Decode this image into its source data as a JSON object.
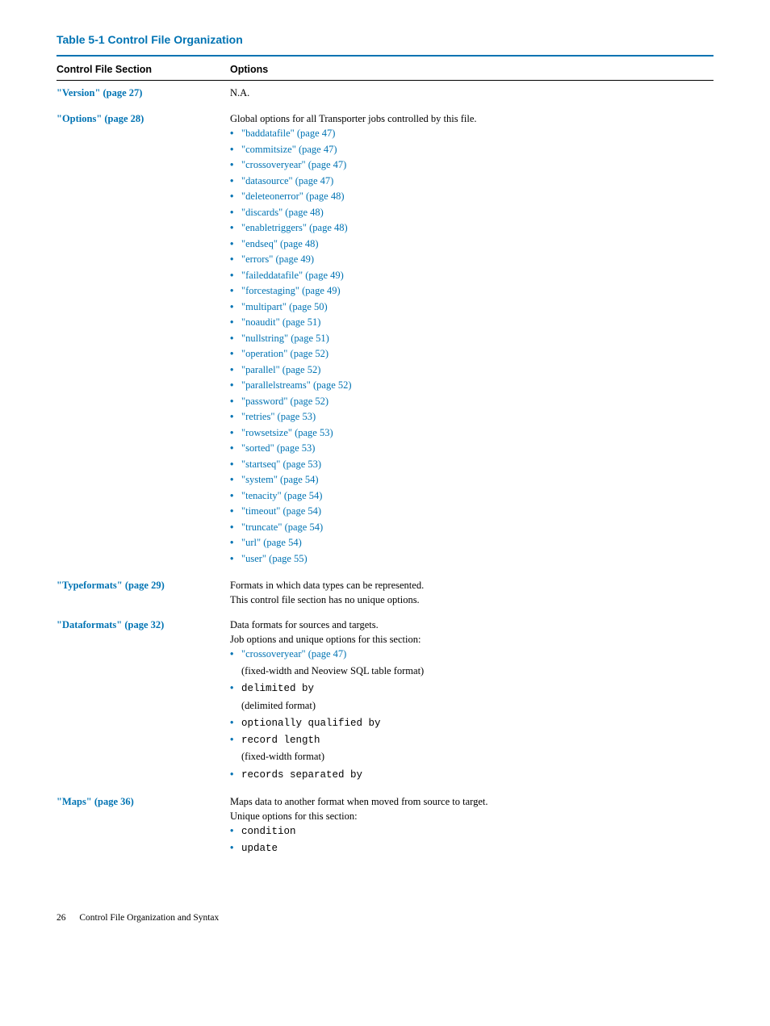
{
  "caption": "Table  5-1  Control File Organization",
  "headers": {
    "col1": "Control File Section",
    "col2": "Options"
  },
  "rows": {
    "version": {
      "section": "\"Version\" (page 27)",
      "options": "N.A."
    },
    "options": {
      "section": "\"Options\" (page 28)",
      "intro": "Global options for all Transporter jobs controlled by this file.",
      "items": [
        "\"baddatafile\" (page 47)",
        "\"commitsize\" (page 47)",
        "\"crossoveryear\" (page 47)",
        "\"datasource\" (page 47)",
        "\"deleteonerror\" (page 48)",
        "\"discards\" (page 48)",
        "\"enabletriggers\" (page 48)",
        "\"endseq\" (page 48)",
        "\"errors\" (page 49)",
        "\"faileddatafile\" (page 49)",
        "\"forcestaging\" (page 49)",
        "\"multipart\" (page 50)",
        "\"noaudit\" (page 51)",
        "\"nullstring\" (page 51)",
        "\"operation\" (page 52)",
        "\"parallel\" (page 52)",
        "\"parallelstreams\" (page 52)",
        "\"password\" (page 52)",
        "\"retries\" (page 53)",
        "\"rowsetsize\" (page 53)",
        "\"sorted\" (page 53)",
        "\"startseq\" (page 53)",
        "\"system\" (page 54)",
        "\"tenacity\" (page 54)",
        "\"timeout\" (page 54)",
        "\"truncate\" (page 54)",
        "\"url\" (page 54)",
        "\"user\" (page 55)"
      ]
    },
    "typeformats": {
      "section": "\"Typeformats\" (page 29)",
      "line1": "Formats in which data types can be represented.",
      "line2": "This control file section has no unique options."
    },
    "dataformats": {
      "section": "\"Dataformats\" (page 32)",
      "line1": "Data formats for sources and targets.",
      "line2": "Job options and unique options for this section:",
      "b1_main": "\"crossoveryear\" (page 47)",
      "b1_sub": "(fixed-width and Neoview SQL table format)",
      "b2_main": "delimited by",
      "b2_sub": "(delimited format)",
      "b3_main": "optionally qualified by",
      "b4_main": "record length",
      "b4_sub": "(fixed-width format)",
      "b5_main": "records separated by"
    },
    "maps": {
      "section": "\"Maps\" (page 36)",
      "line1": "Maps data to another format when moved from source to target.",
      "line2": "Unique options for this section:",
      "items": [
        "condition",
        "update"
      ]
    }
  },
  "footer": {
    "page": "26",
    "chapter": "Control File Organization and Syntax"
  }
}
